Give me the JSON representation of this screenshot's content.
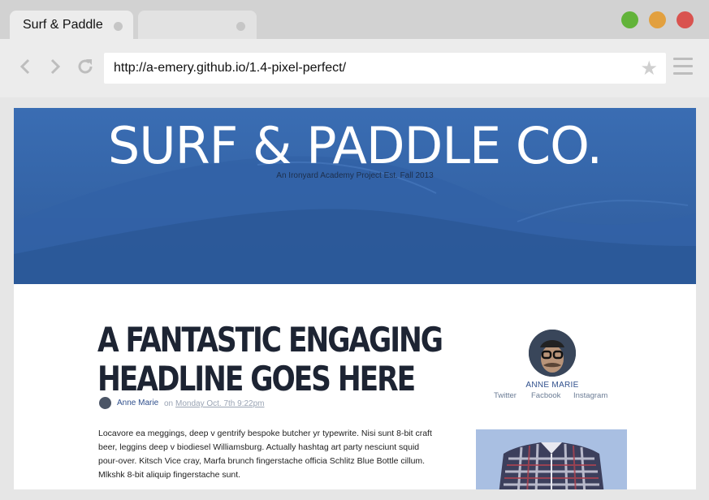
{
  "browser": {
    "tabs": [
      {
        "title": "Surf & Paddle",
        "active": true
      },
      {
        "title": "",
        "active": false
      }
    ],
    "window_buttons": [
      {
        "name": "minimize",
        "color": "#62b33a"
      },
      {
        "name": "zoom",
        "color": "#e2a03f"
      },
      {
        "name": "close",
        "color": "#d9534f"
      }
    ],
    "url": "http://a-emery.github.io/1.4-pixel-perfect/",
    "nav_icons": [
      "back-icon",
      "forward-icon",
      "reload-icon"
    ],
    "bookmark_icon": "star-icon",
    "menu_icon": "hamburger-menu-icon"
  },
  "page": {
    "site_title": "SURF & PADDLE CO.",
    "tagline": "An Ironyard Academy Project Est. Fall 2013",
    "hero_color": "#3766a8",
    "article": {
      "headline_line1": "A FANTASTIC ENGAGING",
      "headline_line2": "HEADLINE GOES HERE",
      "author": "Anne Marie",
      "on_label": "on",
      "date": "Monday Oct. 7th 9:22pm",
      "body": "Locavore ea meggings, deep v gentrify bespoke butcher yr typewrite. Nisi sunt 8-bit craft beer, leggins deep v biodiesel Williamsburg. Actually hashtag art party nesciunt squid pour-over. Kitsch Vice cray, Marfa brunch fingerstache officia Schlitz Blue Bottle cillum. Mlkshk 8-bit aliquip fingerstache sunt."
    },
    "sidebar": {
      "name": "ANNE MARIE",
      "links": [
        "Twitter",
        "Facbook",
        "Instagram"
      ]
    }
  }
}
